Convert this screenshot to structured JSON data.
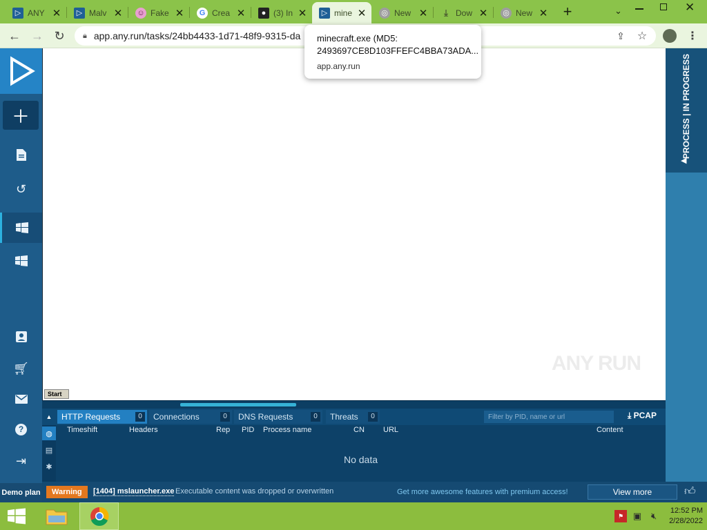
{
  "browser": {
    "tabs": [
      {
        "title": "ANY",
        "icon": "anyrun-icon",
        "active": false
      },
      {
        "title": "Malv",
        "icon": "anyrun-icon",
        "active": false
      },
      {
        "title": "Fake",
        "icon": "smiley-icon",
        "active": false
      },
      {
        "title": "Crea",
        "icon": "google-icon",
        "active": false
      },
      {
        "title": "(3) In",
        "icon": "github-icon",
        "active": false
      },
      {
        "title": "mine",
        "icon": "anyrun-icon",
        "active": true
      },
      {
        "title": "New",
        "icon": "chrome-icon",
        "active": false
      },
      {
        "title": "Dow",
        "icon": "download-icon",
        "active": false
      },
      {
        "title": "New",
        "icon": "chrome-icon",
        "active": false
      }
    ],
    "new_tab_glyph": "+",
    "address": "app.any.run/tasks/24bb4433-1d71-48f9-9315-da",
    "tooltip": {
      "title_line1": "minecraft.exe (MD5:",
      "title_line2": "2493697CE8D103FFEFC4BBA73ADA...",
      "domain": "app.any.run"
    }
  },
  "sidebar": {
    "demo_plan_label": "Demo plan"
  },
  "vm_screen": {
    "watermark": "ANY RUN",
    "start_label": "Start"
  },
  "right_panel": {
    "label": "PROCESS | IN PROGRESS"
  },
  "network": {
    "tabs": [
      {
        "label": "HTTP Requests",
        "count": "0"
      },
      {
        "label": "Connections",
        "count": "0"
      },
      {
        "label": "DNS Requests",
        "count": "0"
      },
      {
        "label": "Threats",
        "count": "0"
      }
    ],
    "filter_placeholder": "Filter by PID, name or url",
    "pcap_label": "PCAP",
    "columns": [
      "Timeshift",
      "Headers",
      "Rep",
      "PID",
      "Process name",
      "CN",
      "URL",
      "Content"
    ],
    "empty_text": "No data"
  },
  "status": {
    "warning_badge": "Warning",
    "process": "[1404] mslauncher.exe",
    "message": "Executable content was dropped or overwritten",
    "promo": "Get more awesome features with premium access!",
    "view_more": "View more"
  },
  "taskbar": {
    "time": "12:52 PM",
    "date": "2/28/2022"
  },
  "colors": {
    "chrome_frame": "#8bc34a",
    "sidebar": "#1e5c8a",
    "accent": "#2380c2",
    "warning": "#e4781f"
  }
}
